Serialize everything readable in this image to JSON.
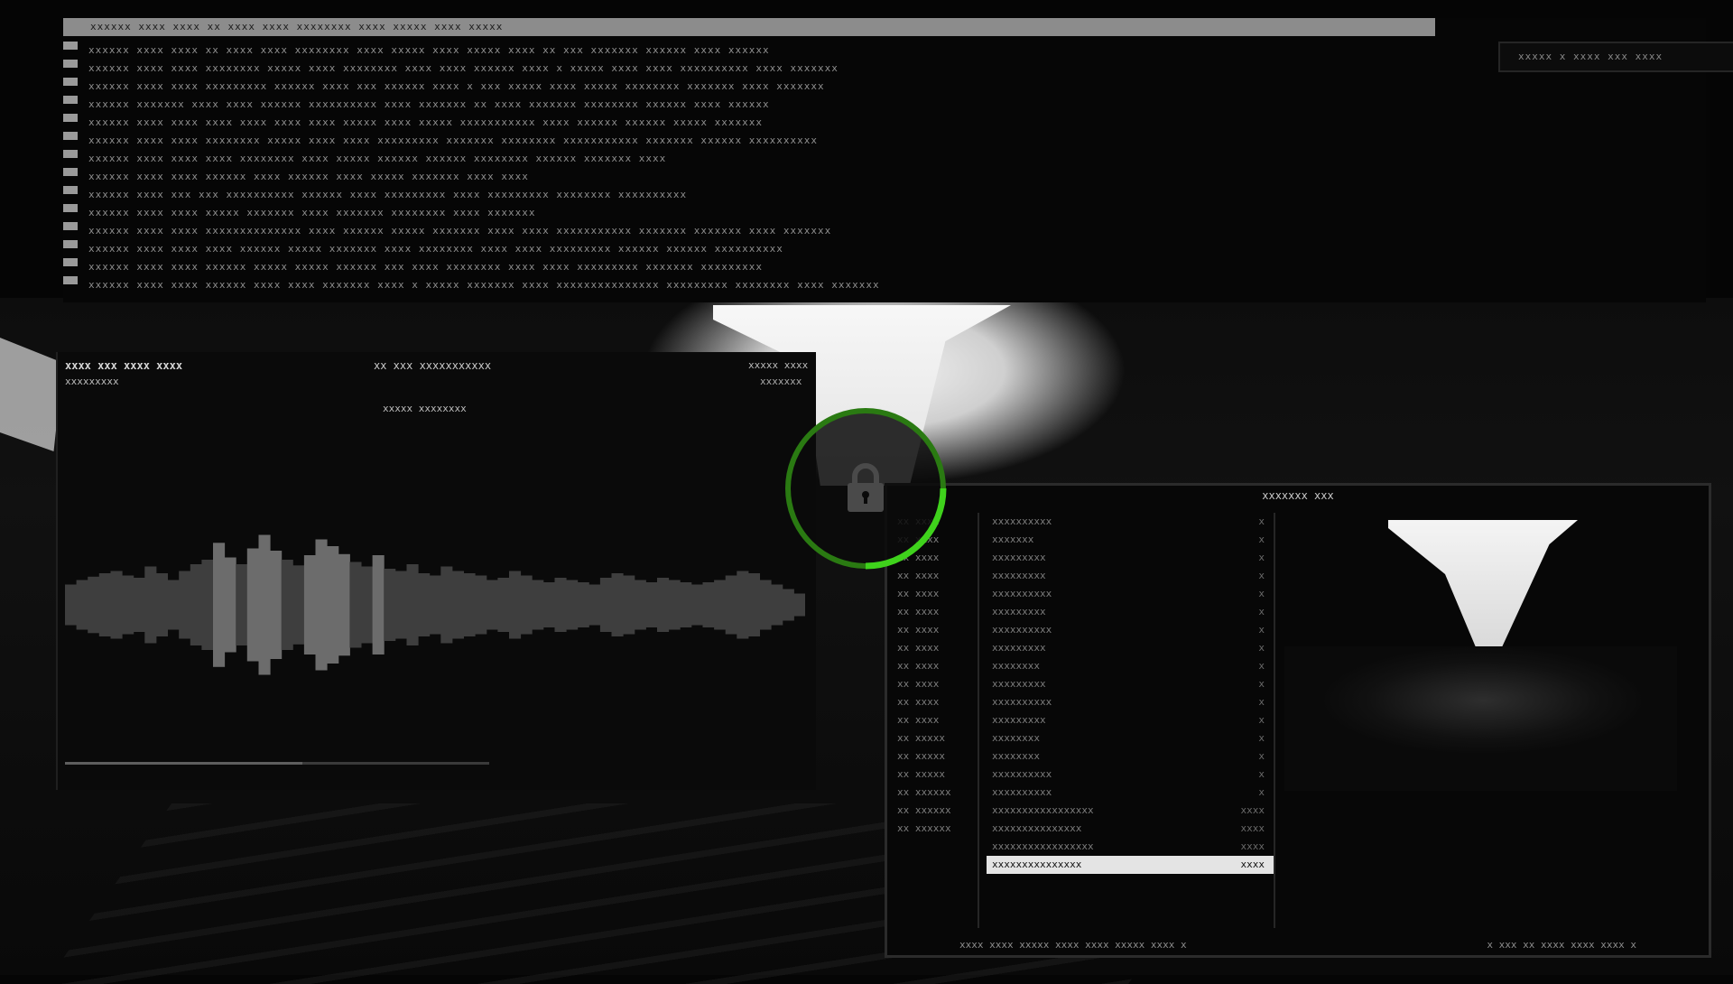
{
  "colors": {
    "ring_accent": "#3fd21c",
    "ring_dim": "#2a7a12",
    "lock_fill": "#4a4a4a"
  },
  "lock": {
    "icon": "padlock-icon",
    "label": ""
  },
  "terminal": {
    "header": "xxxxxx xxxx xxxx xx xxxx  xxxx  xxxxxxxx xxxx xxxxx xxxx xxxxx",
    "status": "xxxxx  x xxxx xxx  xxxx",
    "lines": [
      "xxxxxx xxxx xxxx xx xxxx  xxxx  xxxxxxxx xxxx xxxxx xxxx  xxxxx  xxxx  xx xxx  xxxxxxx xxxxxx  xxxx xxxxxx",
      "xxxxxx xxxx xxxx xxxxxxxx xxxxx xxxx  xxxxxxxx xxxx xxxx xxxxxx xxxx  x xxxxx  xxxx  xxxx xxxxxxxxxx  xxxx xxxxxxx",
      "xxxxxx xxxx xxxx xxxxxxxxx xxxxxx xxxx xxx xxxxxx xxxx  x xxx  xxxxx  xxxx  xxxxx xxxxxxxx xxxxxxx  xxxx xxxxxxx",
      "xxxxxx xxxxxxx xxxx xxxx  xxxxxx xxxxxxxxxx  xxxx  xxxxxxx  xx xxxx  xxxxxxx xxxxxxxx  xxxxxx xxxx xxxxxx",
      "xxxxxx xxxx xxxx xxxx xxxx xxxx xxxx xxxxx  xxxx  xxxxx  xxxxxxxxxxx xxxx xxxxxx  xxxxxx xxxxx xxxxxxx",
      "xxxxxx xxxx xxxx xxxxxxxx xxxxx xxxx xxxx xxxxxxxxx xxxxxxx xxxxxxxx xxxxxxxxxxx  xxxxxxx xxxxxx  xxxxxxxxxx",
      "xxxxxx xxxx xxxx xxxx xxxxxxxx  xxxx xxxxx xxxxxx  xxxxxx xxxxxxxx  xxxxxx  xxxxxxx xxxx",
      "xxxxxx xxxx xxxx xxxxxx  xxxx xxxxxx xxxx xxxxx  xxxxxxx xxxx xxxx",
      "xxxxxx xxxx xxx xxx  xxxxxxxxxx   xxxxxx xxxx   xxxxxxxxx  xxxx xxxxxxxxx xxxxxxxx   xxxxxxxxxx",
      "xxxxxx xxxx xxxx  xxxxx   xxxxxxx xxxx xxxxxxx xxxxxxxx  xxxx xxxxxxx",
      "xxxxxx xxxx xxxx xxxxxxxxxxxxxx xxxx  xxxxxx  xxxxx  xxxxxxx xxxx xxxx xxxxxxxxxxx  xxxxxxx xxxxxxx  xxxx xxxxxxx",
      "xxxxxx xxxx xxxx xxxx xxxxxx  xxxxx  xxxxxxx  xxxx  xxxxxxxx  xxxx xxxx xxxxxxxxx xxxxxx xxxxxx  xxxxxxxxxx",
      "xxxxxx xxxx xxxx xxxxxx xxxxx  xxxxx  xxxxxx  xxx xxxx  xxxxxxxx xxxx xxxx xxxxxxxxx xxxxxxx  xxxxxxxxx",
      "xxxxxx xxxx xxxx xxxxxx xxxx xxxx  xxxxxxx  xxxx x  xxxxx  xxxxxxx xxxx xxxxxxxxxxxxxxx xxxxxxxxx xxxxxxxx  xxxx xxxxxxx"
    ]
  },
  "visualizer": {
    "title": "xxxx xxx xxxx xxxx",
    "subtitle": "xxxxxxxxx",
    "artist": "xx xxx xxxxxxxxxxx",
    "track": "xxxxx  xxxxxxxx",
    "time": "xxxxx xxxx",
    "time2": "xxxxxxx",
    "progress": 0.56,
    "wave_levels": [
      0.18,
      0.22,
      0.25,
      0.28,
      0.3,
      0.26,
      0.24,
      0.34,
      0.28,
      0.22,
      0.3,
      0.36,
      0.4,
      0.55,
      0.42,
      0.36,
      0.5,
      0.62,
      0.48,
      0.4,
      0.35,
      0.44,
      0.58,
      0.52,
      0.45,
      0.38,
      0.34,
      0.44,
      0.32,
      0.3,
      0.36,
      0.28,
      0.26,
      0.34,
      0.3,
      0.28,
      0.26,
      0.22,
      0.24,
      0.3,
      0.26,
      0.22,
      0.2,
      0.24,
      0.22,
      0.2,
      0.18,
      0.24,
      0.28,
      0.26,
      0.22,
      0.2,
      0.24,
      0.22,
      0.2,
      0.18,
      0.2,
      0.22,
      0.26,
      0.3,
      0.28,
      0.22,
      0.18,
      0.14,
      0.1
    ]
  },
  "filemgr": {
    "title": "xxxxxxx xxx",
    "parent_rows": [
      "xx xxxx",
      "xx xxxx",
      "xx xxxx",
      "xx xxxx",
      "xx xxxx",
      "xx xxxx",
      "xx xxxx",
      "xx xxxx",
      "xx xxxx",
      "xx xxxx",
      "xx xxxx",
      "xx xxxx",
      "xx xxxxx",
      "xx xxxxx",
      "xx xxxxx",
      "xx xxxxxx",
      "xx xxxxxx",
      "xx xxxxxx"
    ],
    "rows": [
      {
        "name": "xxxxxxxxxx",
        "size": "x"
      },
      {
        "name": "xxxxxxx",
        "size": "x"
      },
      {
        "name": "xxxxxxxxx",
        "size": "x"
      },
      {
        "name": "xxxxxxxxx",
        "size": "x"
      },
      {
        "name": "xxxxxxxxxx",
        "size": "x"
      },
      {
        "name": "xxxxxxxxx",
        "size": "x"
      },
      {
        "name": "xxxxxxxxxx",
        "size": "x"
      },
      {
        "name": "xxxxxxxxx",
        "size": "x"
      },
      {
        "name": "xxxxxxxx",
        "size": "x"
      },
      {
        "name": "xxxxxxxxx",
        "size": "x"
      },
      {
        "name": "xxxxxxxxxx",
        "size": "x"
      },
      {
        "name": "xxxxxxxxx",
        "size": "x"
      },
      {
        "name": "xxxxxxxx",
        "size": "x"
      },
      {
        "name": "xxxxxxxx",
        "size": "x"
      },
      {
        "name": "xxxxxxxxxx",
        "size": "x"
      },
      {
        "name": "xxxxxxxxxx",
        "size": "x"
      },
      {
        "name": "xxxxxxxxxxxxxxxxx",
        "size": "xxxx"
      },
      {
        "name": "xxxxxxxxxxxxxxx",
        "size": "xxxx"
      },
      {
        "name": "xxxxxxxxxxxxxxxxx",
        "size": "xxxx"
      }
    ],
    "selected_row": {
      "name": "xxxxxxxxxxxxxxx",
      "size": "xxxx"
    },
    "footer_left": "xxxx xxxx xxxxx xxxx  xxxx xxxxx xxxx  x",
    "footer_right": "x xxx xx xxxx xxxx  xxxx x"
  }
}
